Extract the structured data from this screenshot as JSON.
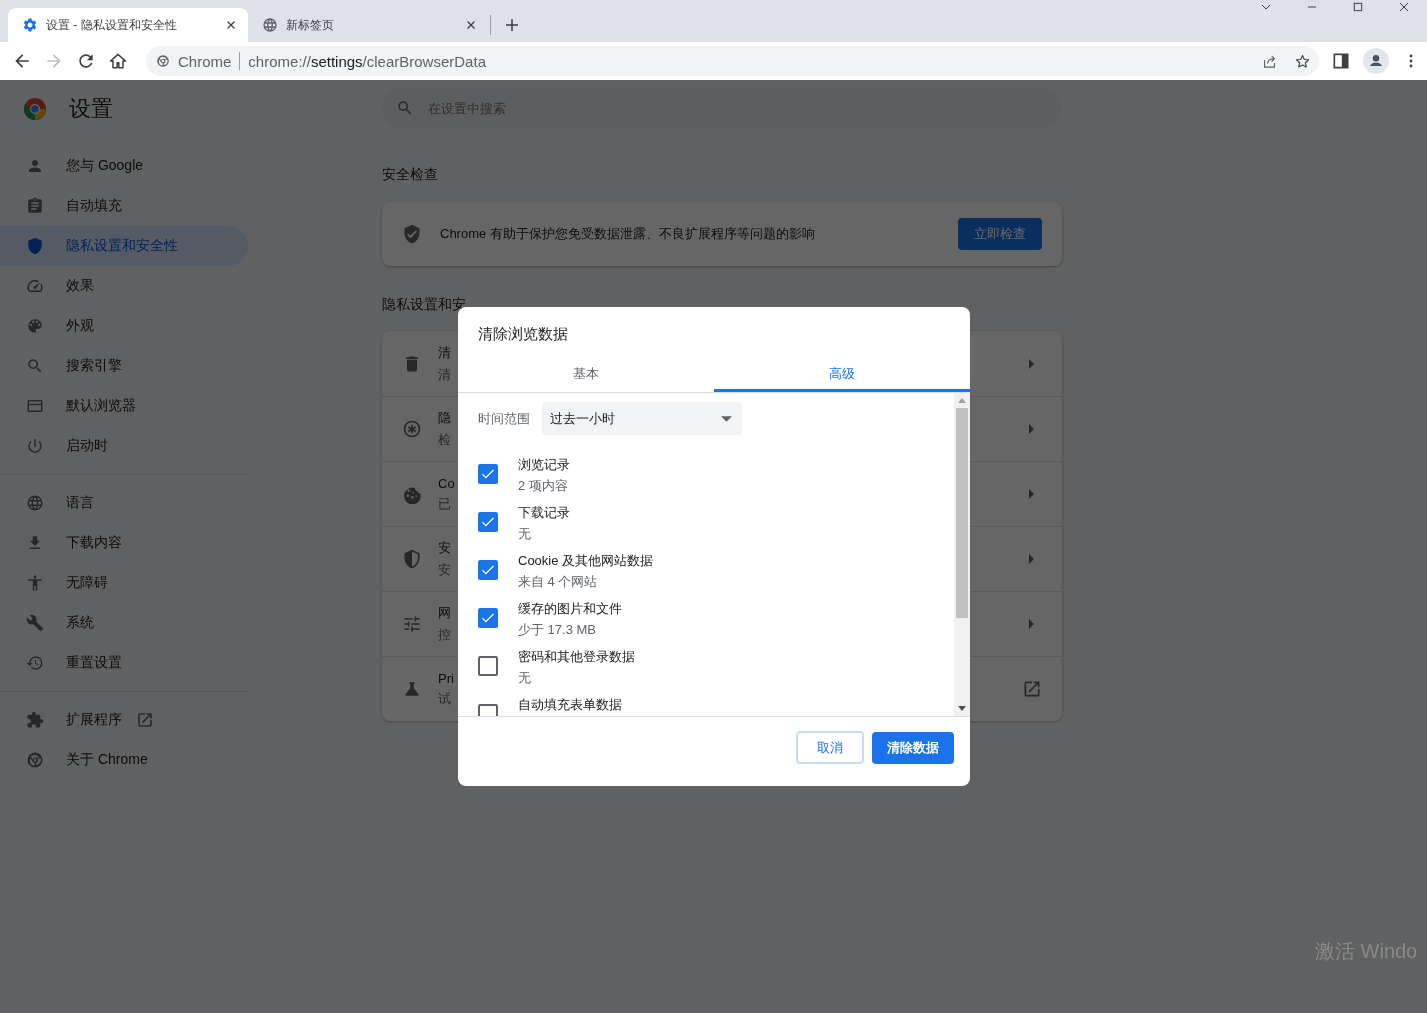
{
  "browser_tabs": [
    {
      "title": "设置 - 隐私设置和安全性",
      "selected": true
    },
    {
      "title": "新标签页",
      "selected": false
    }
  ],
  "address_bar": {
    "site_label": "Chrome",
    "url": "chrome://**settings**/clearBrowserData"
  },
  "settings_header": {
    "title": "设置",
    "search_placeholder": "在设置中搜索"
  },
  "sidebar": {
    "groups": [
      [
        {
          "label": "您与 Google",
          "selected": false
        },
        {
          "label": "自动填充",
          "selected": false
        },
        {
          "label": "隐私设置和安全性",
          "selected": true
        },
        {
          "label": "效果",
          "selected": false
        },
        {
          "label": "外观",
          "selected": false
        },
        {
          "label": "搜索引擎",
          "selected": false
        },
        {
          "label": "默认浏览器",
          "selected": false
        },
        {
          "label": "启动时",
          "selected": false
        }
      ],
      [
        {
          "label": "语言",
          "selected": false
        },
        {
          "label": "下载内容",
          "selected": false
        },
        {
          "label": "无障碍",
          "selected": false
        },
        {
          "label": "系统",
          "selected": false
        },
        {
          "label": "重置设置",
          "selected": false
        }
      ],
      [
        {
          "label": "扩展程序",
          "selected": false
        },
        {
          "label": "关于 Chrome",
          "selected": false
        }
      ]
    ]
  },
  "safety_check": {
    "heading": "安全检查",
    "text": "Chrome 有助于保护您免受数据泄露、不良扩展程序等问题的影响",
    "button": "立即检查"
  },
  "privacy_section": {
    "heading": "隐私设置和安",
    "rows": [
      {
        "title": "清",
        "subtitle": "清"
      },
      {
        "title": "隐",
        "subtitle": "检"
      },
      {
        "title": "Co",
        "subtitle": "已"
      },
      {
        "title": "安",
        "subtitle": "安"
      },
      {
        "title": "网",
        "subtitle": "控"
      },
      {
        "title": "Pri",
        "subtitle": "试"
      }
    ]
  },
  "dialog": {
    "title": "清除浏览数据",
    "tabs": [
      {
        "label": "基本",
        "selected": false
      },
      {
        "label": "高级",
        "selected": true
      }
    ],
    "time_range": {
      "label": "时间范围",
      "value": "过去一小时"
    },
    "options": [
      {
        "label": "浏览记录",
        "detail": "2 项内容",
        "checked": true
      },
      {
        "label": "下载记录",
        "detail": "无",
        "checked": true
      },
      {
        "label": "Cookie 及其他网站数据",
        "detail": "来自 4 个网站",
        "checked": true
      },
      {
        "label": "缓存的图片和文件",
        "detail": "少于 17.3 MB",
        "checked": true
      },
      {
        "label": "密码和其他登录数据",
        "detail": "无",
        "checked": false
      },
      {
        "label": "自动填充表单数据",
        "checked": false
      }
    ],
    "cancel_button": "取消",
    "confirm_button": "清除数据"
  },
  "os_notice": "激活 Windo"
}
